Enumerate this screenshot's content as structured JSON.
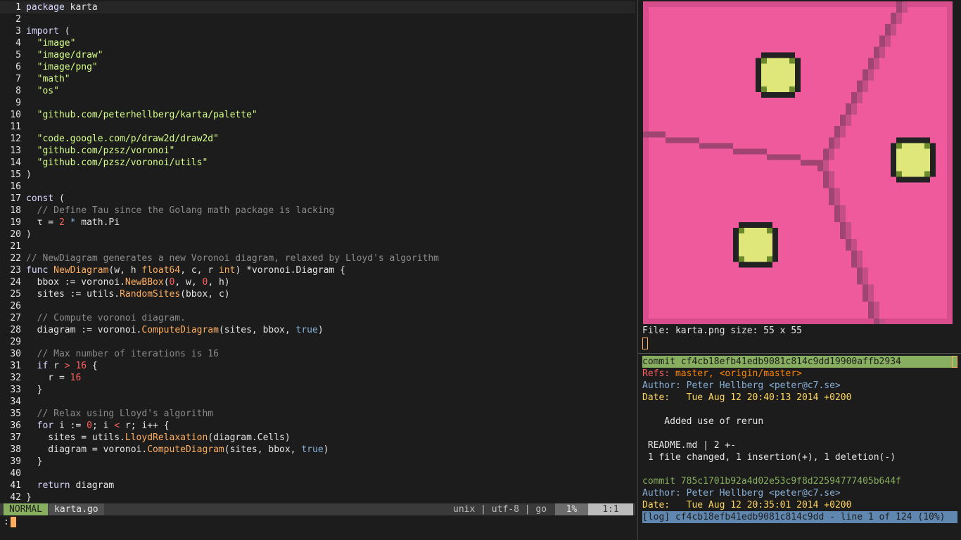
{
  "editor": {
    "lines": [
      {
        "n": "1",
        "segs": [
          [
            "kw",
            "package"
          ],
          [
            "plain",
            " karta"
          ]
        ]
      },
      {
        "n": "2",
        "segs": []
      },
      {
        "n": "3",
        "segs": [
          [
            "kw",
            "import"
          ],
          [
            "plain",
            " ("
          ]
        ]
      },
      {
        "n": "4",
        "segs": [
          [
            "plain",
            "  "
          ],
          [
            "str",
            "\"image\""
          ]
        ]
      },
      {
        "n": "5",
        "segs": [
          [
            "plain",
            "  "
          ],
          [
            "str",
            "\"image/draw\""
          ]
        ]
      },
      {
        "n": "6",
        "segs": [
          [
            "plain",
            "  "
          ],
          [
            "str",
            "\"image/png\""
          ]
        ]
      },
      {
        "n": "7",
        "segs": [
          [
            "plain",
            "  "
          ],
          [
            "str",
            "\"math\""
          ]
        ]
      },
      {
        "n": "8",
        "segs": [
          [
            "plain",
            "  "
          ],
          [
            "str",
            "\"os\""
          ]
        ]
      },
      {
        "n": "9",
        "segs": []
      },
      {
        "n": "10",
        "segs": [
          [
            "plain",
            "  "
          ],
          [
            "str",
            "\"github.com/peterhellberg/karta/palette\""
          ]
        ]
      },
      {
        "n": "11",
        "segs": []
      },
      {
        "n": "12",
        "segs": [
          [
            "plain",
            "  "
          ],
          [
            "str",
            "\"code.google.com/p/draw2d/draw2d\""
          ]
        ]
      },
      {
        "n": "13",
        "segs": [
          [
            "plain",
            "  "
          ],
          [
            "str",
            "\"github.com/pzsz/voronoi\""
          ]
        ]
      },
      {
        "n": "14",
        "segs": [
          [
            "plain",
            "  "
          ],
          [
            "str",
            "\"github.com/pzsz/voronoi/utils\""
          ]
        ]
      },
      {
        "n": "15",
        "segs": [
          [
            "plain",
            ")"
          ]
        ]
      },
      {
        "n": "16",
        "segs": []
      },
      {
        "n": "17",
        "segs": [
          [
            "kw",
            "const"
          ],
          [
            "plain",
            " ("
          ]
        ]
      },
      {
        "n": "18",
        "segs": [
          [
            "plain",
            "  "
          ],
          [
            "cmt",
            "// Define Tau since the Golang math package is lacking"
          ]
        ]
      },
      {
        "n": "19",
        "segs": [
          [
            "plain",
            "  τ = "
          ],
          [
            "num",
            "2"
          ],
          [
            "plain",
            " "
          ],
          [
            "bool",
            "*"
          ],
          [
            "plain",
            " math.Pi"
          ]
        ]
      },
      {
        "n": "20",
        "segs": [
          [
            "plain",
            ")"
          ]
        ]
      },
      {
        "n": "21",
        "segs": []
      },
      {
        "n": "22",
        "segs": [
          [
            "cmt",
            "// NewDiagram generates a new Voronoi diagram, relaxed by Lloyd's algorithm"
          ]
        ]
      },
      {
        "n": "23",
        "segs": [
          [
            "kw",
            "func"
          ],
          [
            "plain",
            " "
          ],
          [
            "fn",
            "NewDiagram"
          ],
          [
            "plain",
            "(w, h "
          ],
          [
            "fn",
            "float64"
          ],
          [
            "plain",
            ", c, r "
          ],
          [
            "fn",
            "int"
          ],
          [
            "plain",
            ") *voronoi.Diagram {"
          ]
        ]
      },
      {
        "n": "24",
        "segs": [
          [
            "plain",
            "  bbox := voronoi."
          ],
          [
            "fn",
            "NewBBox"
          ],
          [
            "plain",
            "("
          ],
          [
            "num",
            "0"
          ],
          [
            "plain",
            ", w, "
          ],
          [
            "num",
            "0"
          ],
          [
            "plain",
            ", h)"
          ]
        ]
      },
      {
        "n": "25",
        "segs": [
          [
            "plain",
            "  sites := utils."
          ],
          [
            "fn",
            "RandomSites"
          ],
          [
            "plain",
            "(bbox, c)"
          ]
        ]
      },
      {
        "n": "26",
        "segs": []
      },
      {
        "n": "27",
        "segs": [
          [
            "plain",
            "  "
          ],
          [
            "cmt",
            "// Compute voronoi diagram."
          ]
        ]
      },
      {
        "n": "28",
        "segs": [
          [
            "plain",
            "  diagram := voronoi."
          ],
          [
            "fn",
            "ComputeDiagram"
          ],
          [
            "plain",
            "(sites, bbox, "
          ],
          [
            "bool",
            "true"
          ],
          [
            "plain",
            ")"
          ]
        ]
      },
      {
        "n": "29",
        "segs": []
      },
      {
        "n": "30",
        "segs": [
          [
            "plain",
            "  "
          ],
          [
            "cmt",
            "// Max number of iterations is 16"
          ]
        ]
      },
      {
        "n": "31",
        "segs": [
          [
            "plain",
            "  "
          ],
          [
            "kw",
            "if"
          ],
          [
            "plain",
            " r "
          ],
          [
            "num",
            ">"
          ],
          [
            "plain",
            " "
          ],
          [
            "num",
            "16"
          ],
          [
            "plain",
            " {"
          ]
        ]
      },
      {
        "n": "32",
        "segs": [
          [
            "plain",
            "    r = "
          ],
          [
            "num",
            "16"
          ]
        ]
      },
      {
        "n": "33",
        "segs": [
          [
            "plain",
            "  }"
          ]
        ]
      },
      {
        "n": "34",
        "segs": []
      },
      {
        "n": "35",
        "segs": [
          [
            "plain",
            "  "
          ],
          [
            "cmt",
            "// Relax using Lloyd's algorithm"
          ]
        ]
      },
      {
        "n": "36",
        "segs": [
          [
            "plain",
            "  "
          ],
          [
            "kw",
            "for"
          ],
          [
            "plain",
            " i := "
          ],
          [
            "num",
            "0"
          ],
          [
            "plain",
            "; i "
          ],
          [
            "num",
            "<"
          ],
          [
            "plain",
            " r; i++ {"
          ]
        ]
      },
      {
        "n": "37",
        "segs": [
          [
            "plain",
            "    sites = utils."
          ],
          [
            "fn",
            "LloydRelaxation"
          ],
          [
            "plain",
            "(diagram.Cells)"
          ]
        ]
      },
      {
        "n": "38",
        "segs": [
          [
            "plain",
            "    diagram = voronoi."
          ],
          [
            "fn",
            "ComputeDiagram"
          ],
          [
            "plain",
            "(sites, bbox, "
          ],
          [
            "bool",
            "true"
          ],
          [
            "plain",
            ")"
          ]
        ]
      },
      {
        "n": "39",
        "segs": [
          [
            "plain",
            "  }"
          ]
        ]
      },
      {
        "n": "40",
        "segs": []
      },
      {
        "n": "41",
        "segs": [
          [
            "plain",
            "  "
          ],
          [
            "kw",
            "return"
          ],
          [
            "plain",
            " diagram"
          ]
        ]
      },
      {
        "n": "42",
        "segs": [
          [
            "plain",
            "}"
          ]
        ]
      }
    ]
  },
  "statusline": {
    "mode": "NORMAL",
    "filename": "karta.go",
    "fileinfo": "unix | utf-8 | go",
    "percent": "1%",
    "position": "1:1"
  },
  "cmdline": {
    "prompt": ":"
  },
  "image_pane": {
    "file_info": "File: karta.png size: 55 x 55",
    "colors": {
      "background": "#ee5a9b",
      "edge": "#a04472",
      "site": "#dfe67a",
      "site_ring": "#6b8a2e"
    }
  },
  "gitlog": {
    "commit1_line": "commit cf4cb18efb41edb9081c814c9dd19900affb2934",
    "refs_label": "Refs:",
    "refs_value": " master, <origin/master>",
    "author1": "Author: Peter Hellberg <peter@c7.se>",
    "date1_label": "Date:",
    "date1_value": "   Tue Aug 12 20:40:13 2014 +0200",
    "message": "    Added use of rerun",
    "stat_file": " README.md | 2 +-",
    "stat_summary": " 1 file changed, 1 insertion(+), 1 deletion(-)",
    "commit2_line": "commit 785c1701b92a4d02e53c9f8d22594777405b644f",
    "author2": "Author: Peter Hellberg <peter@c7.se>",
    "date2_label": "Date:",
    "date2_value": "   Tue Aug 12 20:35:01 2014 +0200",
    "log_status": "[log] cf4cb18efb41edb9081c814c9dd - line 1 of 124 (10%)"
  }
}
